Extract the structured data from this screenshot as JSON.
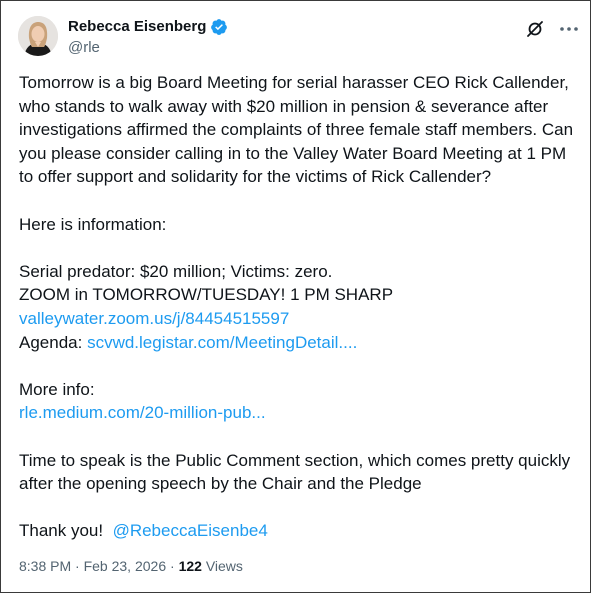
{
  "author": {
    "name": "Rebecca Eisenberg",
    "handle": "@rle",
    "verified": true,
    "verified_color": "#1d9bf0"
  },
  "tweet": {
    "para1": "Tomorrow is a big Board Meeting for serial harasser CEO Rick Callender, who stands to walk away with $20 million in pension & severance after investigations affirmed the complaints of three female staff members. Can you please consider calling in to the Valley Water Board Meeting at 1 PM to offer support and solidarity for the victims of Rick Callender?",
    "para2": "Here is information:",
    "line_predator": "Serial predator: $20 million; Victims: zero.",
    "line_zoom": "ZOOM in TOMORROW/TUESDAY! 1 PM SHARP",
    "zoom_link": "valleywater.zoom.us/j/84454515597",
    "agenda_label": "Agenda:",
    "agenda_link": "scvwd.legistar.com/MeetingDetail....",
    "more_info_label": "More info:",
    "more_info_link": "rle.medium.com/20-million-pub...",
    "para_speak": "Time to speak is the Public Comment section, which comes pretty quickly after the opening speech by the Chair and the Pledge",
    "thanks": "Thank you!",
    "mention": "@RebeccaEisenbe4"
  },
  "meta": {
    "time": "8:38 PM",
    "separator": "·",
    "date": "Feb 23, 2026",
    "views_count": "122",
    "views_label": "Views"
  },
  "icons": {
    "grok": "grok-icon",
    "more": "more-options-icon",
    "verified": "verified-badge-icon"
  },
  "colors": {
    "link": "#1d9bf0",
    "text": "#0f1419",
    "secondary": "#536471"
  }
}
